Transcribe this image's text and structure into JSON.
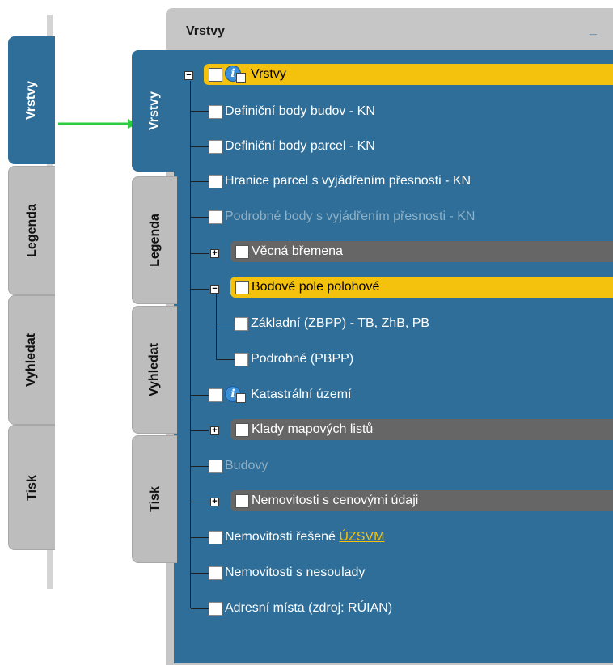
{
  "left_tabs": [
    "Vrstvy",
    "Legenda",
    "Vyhledat",
    "Tisk"
  ],
  "panel": {
    "title": "Vrstvy",
    "minimize": "_"
  },
  "tree": {
    "root": "Vrstvy",
    "items": [
      "Definiční body budov - KN",
      "Definiční body parcel - KN",
      "Hranice parcel s vyjádřením přesnosti - KN",
      "Podrobné body s vyjádřením přesnosti - KN",
      "Věcná břemena",
      "Bodové pole polohové",
      "Základní (ZBPP) - TB, ZhB, PB",
      "Podrobné (PBPP)",
      "Katastrální území",
      "Klady mapových listů",
      "Budovy",
      "Nemovitosti s cenovými údaji",
      "Nemovitosti řešené ",
      "Nemovitosti s nesoulady",
      "Adresní místa (zdroj: RÚIAN)"
    ],
    "link_uzsvm": "ÚZSVM"
  },
  "colors": {
    "panel_blue": "#2e6e98",
    "highlight_yellow": "#f4c20d",
    "group_gray": "#666666",
    "arrow_green": "#2ecc40"
  }
}
